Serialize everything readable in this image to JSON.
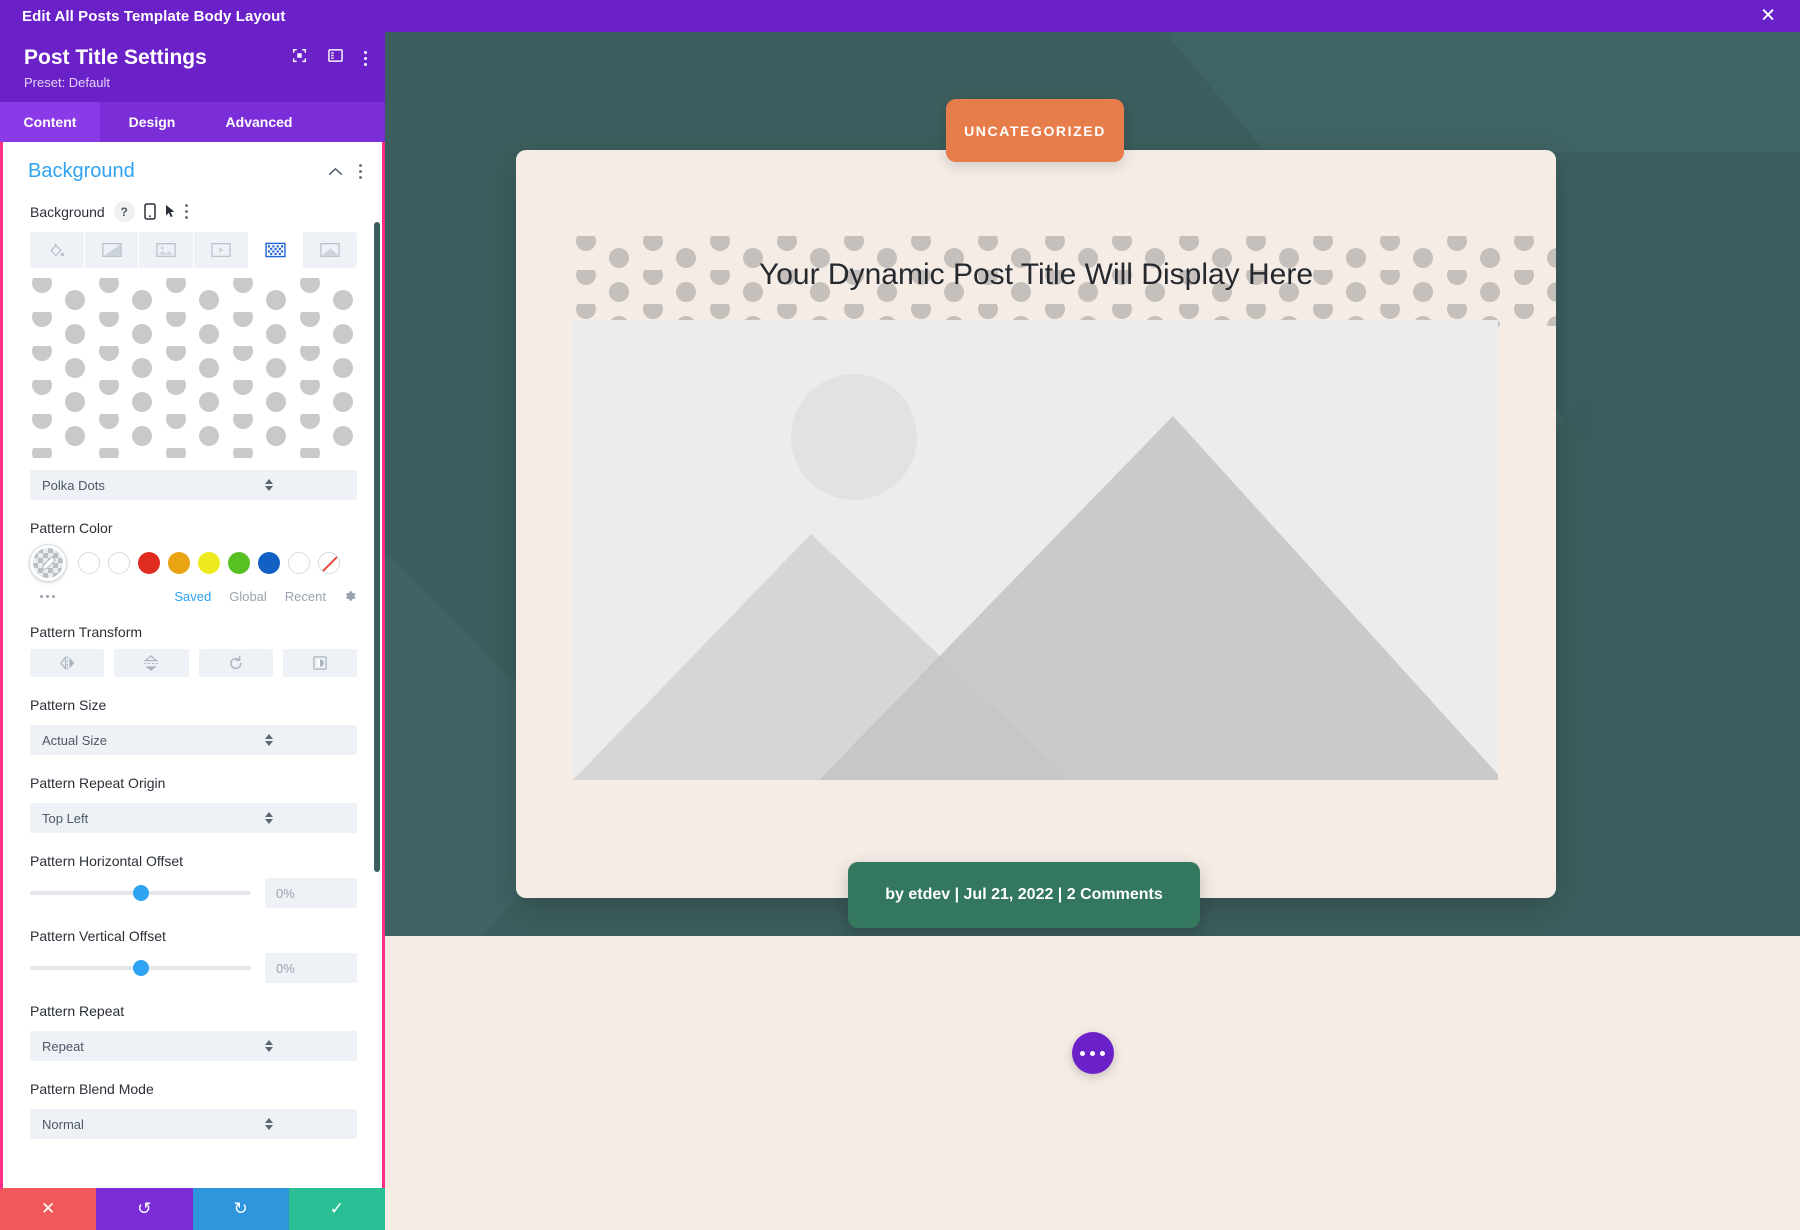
{
  "topbar": {
    "title": "Edit All Posts Template Body Layout",
    "close_icon": "close-icon"
  },
  "panel": {
    "title": "Post Title Settings",
    "preset": "Preset: Default",
    "header_icons": [
      "fullscreen-icon",
      "layout-columns-icon",
      "kebab-menu-icon"
    ],
    "tabs": [
      {
        "label": "Content",
        "active": true
      },
      {
        "label": "Design",
        "active": false
      },
      {
        "label": "Advanced",
        "active": false
      }
    ],
    "section": {
      "title": "Background",
      "collapse_icon": "chevron-up-icon",
      "menu_icon": "kebab-menu-icon"
    },
    "background_field": {
      "label": "Background",
      "help_icon": "question-icon",
      "responsive_icon": "mobile-icon",
      "hover_icon": "cursor-icon",
      "more_icon": "kebab-menu-icon",
      "types": [
        {
          "name": "color-fill",
          "active": false
        },
        {
          "name": "gradient",
          "active": false
        },
        {
          "name": "image",
          "active": false
        },
        {
          "name": "video",
          "active": false
        },
        {
          "name": "pattern",
          "active": true
        },
        {
          "name": "mask",
          "active": false
        }
      ]
    },
    "pattern_select": {
      "value": "Polka Dots"
    },
    "pattern_color": {
      "label": "Pattern Color",
      "selected_swatch": "transparent-edit",
      "swatches": [
        "#ffffff",
        "#ffffff",
        "#e02b20",
        "#e8a511",
        "#edeb1e",
        "#57c022",
        "#1161c4",
        "#ffffff",
        "none"
      ],
      "source_tabs": [
        {
          "label": "Saved",
          "active": true
        },
        {
          "label": "Global",
          "active": false
        },
        {
          "label": "Recent",
          "active": false
        }
      ],
      "settings_icon": "gear-icon",
      "more_icon": "ellipsis-icon"
    },
    "pattern_transform": {
      "label": "Pattern Transform",
      "buttons": [
        "flip-horizontal-icon",
        "flip-vertical-icon",
        "rotate-icon",
        "invert-icon"
      ]
    },
    "pattern_size": {
      "label": "Pattern Size",
      "value": "Actual Size"
    },
    "pattern_repeat_origin": {
      "label": "Pattern Repeat Origin",
      "value": "Top Left"
    },
    "pattern_horizontal_offset": {
      "label": "Pattern Horizontal Offset",
      "value": "0%",
      "knob_percent": 50
    },
    "pattern_vertical_offset": {
      "label": "Pattern Vertical Offset",
      "value": "0%",
      "knob_percent": 50
    },
    "pattern_repeat": {
      "label": "Pattern Repeat",
      "value": "Repeat"
    },
    "pattern_blend_mode": {
      "label": "Pattern Blend Mode",
      "value": "Normal"
    },
    "actions": [
      {
        "name": "cancel-button",
        "icon": "✕",
        "color": "#f0585c"
      },
      {
        "name": "undo-button",
        "icon": "↺",
        "color": "#7b2ed8"
      },
      {
        "name": "redo-button",
        "icon": "↻",
        "color": "#2d96dd"
      },
      {
        "name": "save-button",
        "icon": "✓",
        "color": "#2bbd93"
      }
    ]
  },
  "preview": {
    "category_badge": "UNCATEGORIZED",
    "post_title": "Your Dynamic Post Title Will Display Here",
    "meta": "by etdev | Jul 21, 2022 | 2 Comments",
    "fab_icon": "ellipsis-icon",
    "image_placeholder": "image-placeholder-icon"
  },
  "colors": {
    "brand_purple": "#6b21c8",
    "accent_pink": "#ff2e86",
    "canvas_teal": "#3d5e5e",
    "card_cream": "#f5ece6",
    "badge_orange": "#e87d4c",
    "meta_green": "#34775f",
    "link_blue": "#2ea3f2"
  }
}
